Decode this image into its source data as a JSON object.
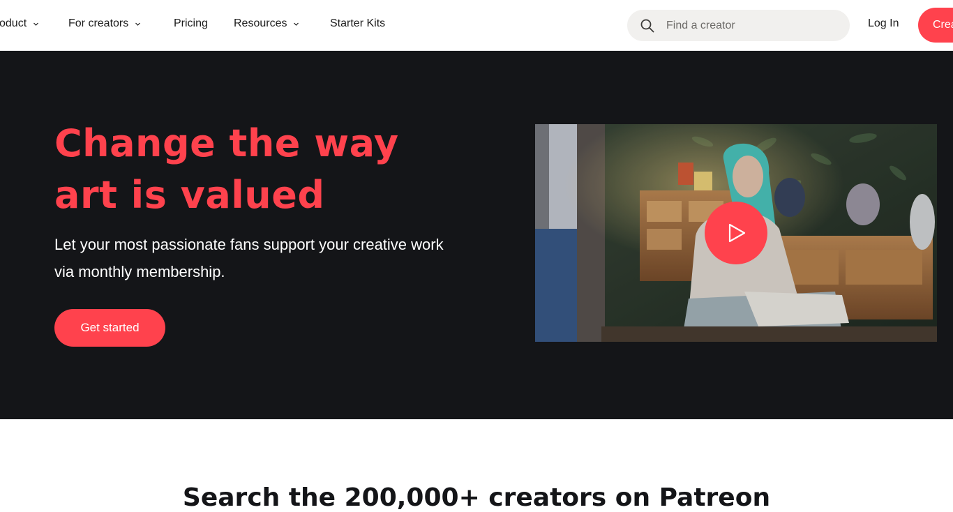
{
  "nav": {
    "items": [
      {
        "label": "Product",
        "has_dropdown": true
      },
      {
        "label": "For creators",
        "has_dropdown": true
      },
      {
        "label": "Pricing",
        "has_dropdown": false
      },
      {
        "label": "Resources",
        "has_dropdown": true
      },
      {
        "label": "Starter Kits",
        "has_dropdown": false
      }
    ],
    "search_placeholder": "Find a creator",
    "search_icon": "search-icon",
    "login_label": "Log In",
    "create_label": "Create on Patreon"
  },
  "hero": {
    "title_line1": "Change the way",
    "title_line2": "art is valued",
    "subtitle": "Let your most passionate fans support your creative work via monthly membership.",
    "cta_label": "Get started",
    "video_play_icon": "play-icon"
  },
  "section": {
    "heading": "Search the 200,000+ creators on Patreon"
  },
  "colors": {
    "accent": "#ff424d",
    "hero_bg": "#141518",
    "search_bg": "#f1f0ee"
  }
}
